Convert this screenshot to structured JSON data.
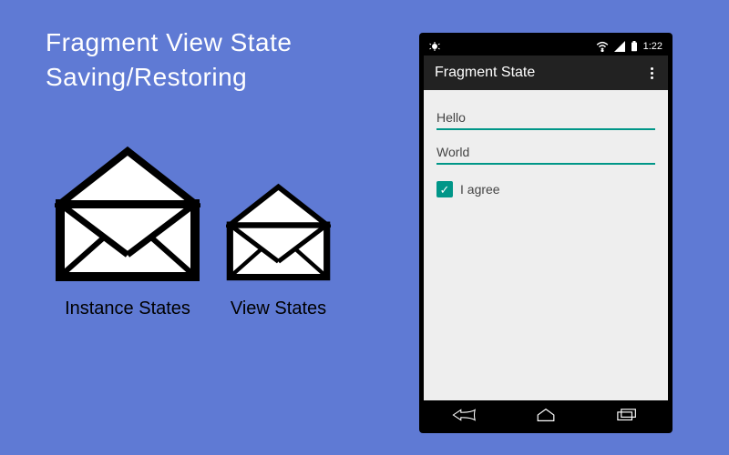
{
  "title_line1": "Fragment View State",
  "title_line2": "Saving/Restoring",
  "envelopes": {
    "instance_label": "Instance States",
    "view_label": "View States"
  },
  "phone": {
    "status": {
      "time": "1:22",
      "icons": {
        "debug": "debug-icon",
        "wifi": "wifi-icon",
        "signal": "signal-icon",
        "battery": "battery-icon"
      }
    },
    "actionbar": {
      "title": "Fragment State",
      "overflow_label": "More"
    },
    "fields": {
      "field1_value": "Hello",
      "field2_value": "World"
    },
    "checkbox": {
      "checked": true,
      "label": "I agree"
    },
    "nav": {
      "back": "back",
      "home": "home",
      "recents": "recents"
    }
  },
  "colors": {
    "bg": "#5f7ad4",
    "accent": "#009688"
  }
}
